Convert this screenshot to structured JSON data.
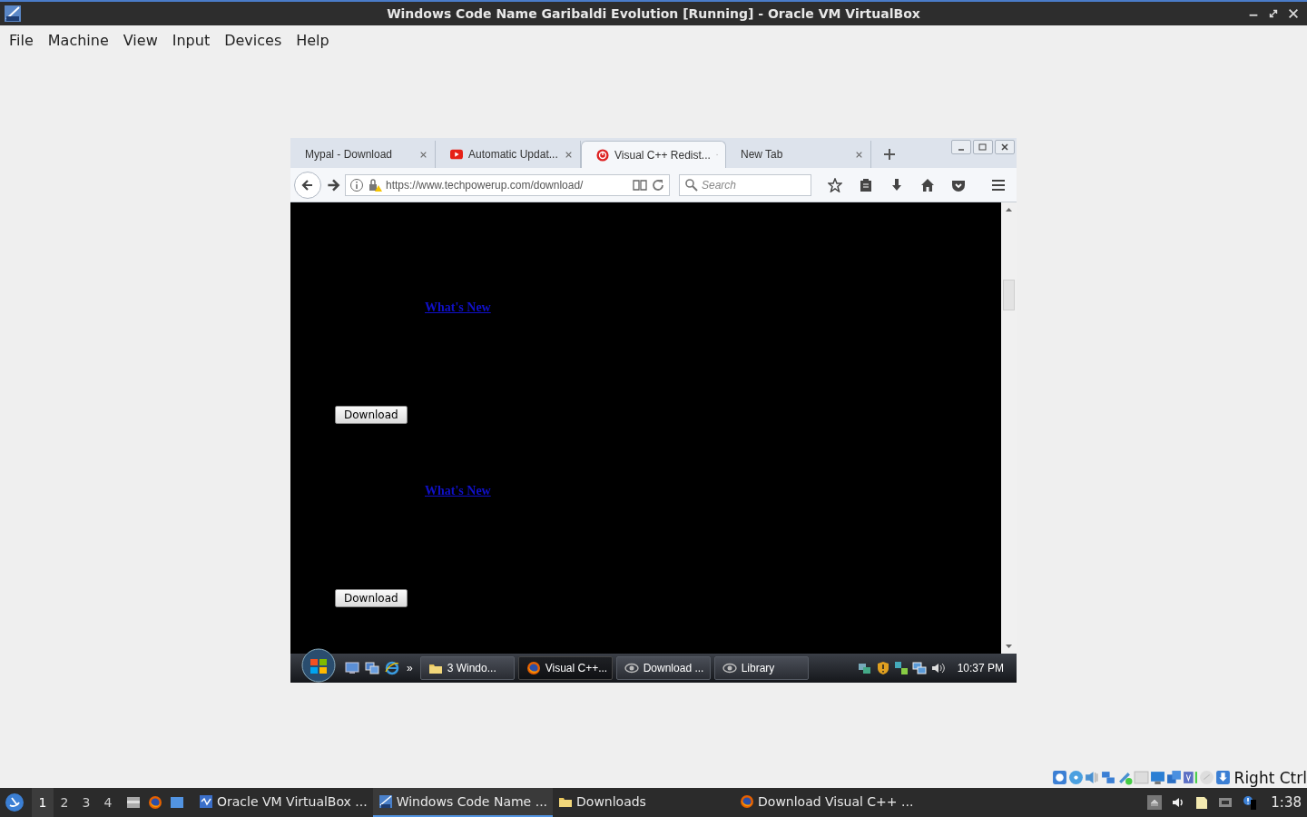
{
  "window": {
    "title": "Windows Code Name Garibaldi Evolution [Running] - Oracle VM VirtualBox"
  },
  "menu": [
    "File",
    "Machine",
    "View",
    "Input",
    "Devices",
    "Help"
  ],
  "guest": {
    "browser": {
      "tabs": [
        {
          "label": "Mypal - Download",
          "selected": false
        },
        {
          "label": "Automatic Updat...",
          "selected": false
        },
        {
          "label": "Visual C++ Redist...",
          "selected": true
        },
        {
          "label": "New Tab",
          "selected": false
        }
      ],
      "url": "https://www.techpowerup.com/download/",
      "search_placeholder": "Search",
      "content": [
        {
          "kind": "link",
          "text": "What's New"
        },
        {
          "kind": "button",
          "text": "Download"
        },
        {
          "kind": "link",
          "text": "What's New"
        },
        {
          "kind": "button",
          "text": "Download"
        }
      ]
    },
    "taskbar": {
      "overflow": "»",
      "buttons": [
        {
          "label": "3 Windo...",
          "selected": false
        },
        {
          "label": "Visual C++...",
          "selected": true
        },
        {
          "label": "Download ...",
          "selected": false
        },
        {
          "label": "Library",
          "selected": false
        }
      ],
      "clock": "10:37 PM"
    }
  },
  "status_bar": {
    "host_key": "Right Ctrl"
  },
  "host_taskbar": {
    "workspaces": [
      {
        "label": "1",
        "selected": true
      },
      {
        "label": "2",
        "selected": false
      },
      {
        "label": "3",
        "selected": false
      },
      {
        "label": "4",
        "selected": false
      }
    ],
    "tasks": [
      {
        "label": "Oracle VM VirtualBox ...",
        "selected": false
      },
      {
        "label": "Windows Code Name ...",
        "selected": true
      },
      {
        "label": "Downloads",
        "selected": false
      },
      {
        "label": "Download Visual C++ ...",
        "selected": false
      }
    ],
    "clock": "1:38"
  }
}
